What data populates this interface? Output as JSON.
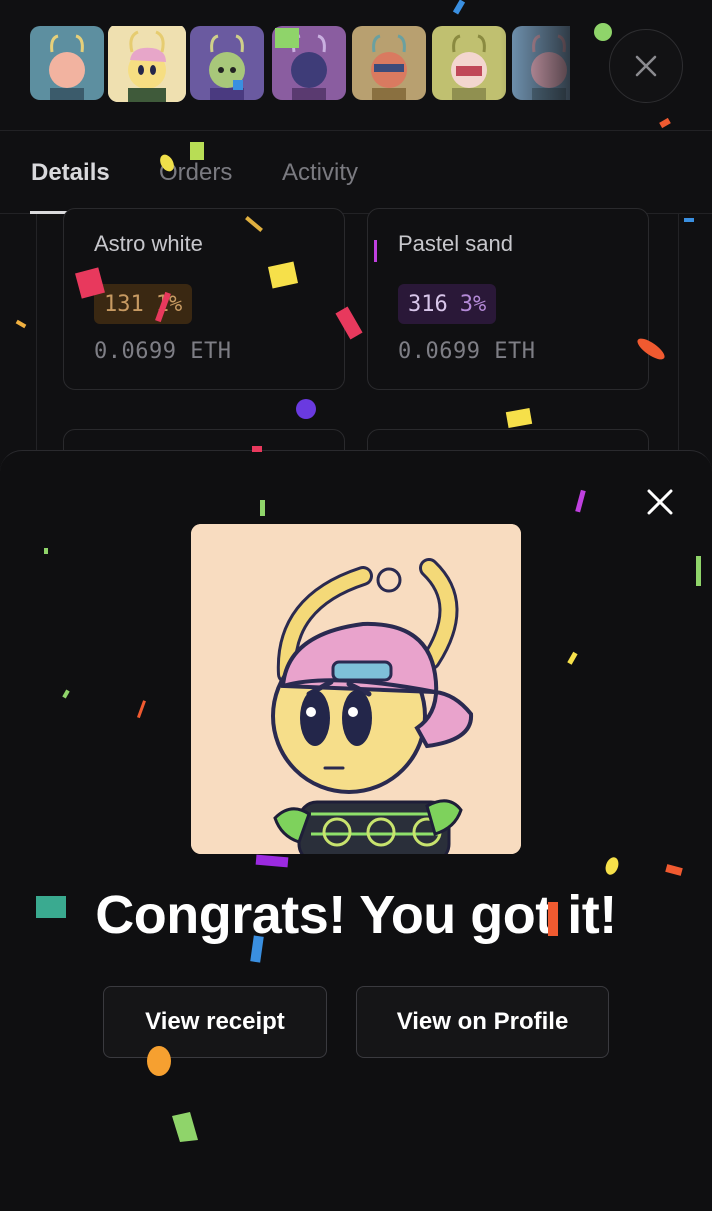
{
  "thumbnails": [
    {
      "name": "thumb-1",
      "bg": "#5d8fa0"
    },
    {
      "name": "thumb-2",
      "bg": "#efe0b0",
      "selected": true
    },
    {
      "name": "thumb-3",
      "bg": "#6a5aa0"
    },
    {
      "name": "thumb-4",
      "bg": "#8a5da0"
    },
    {
      "name": "thumb-5",
      "bg": "#b8a070"
    },
    {
      "name": "thumb-6",
      "bg": "#c0c070"
    },
    {
      "name": "thumb-7",
      "bg": "#7aa0c0"
    }
  ],
  "tabs": {
    "details": "Details",
    "orders": "Orders",
    "activity": "Activity"
  },
  "cards": [
    {
      "name": "Astro white",
      "count": "131",
      "pct": "1%",
      "price": "0.0699",
      "currency": "ETH",
      "pill_bg": "#3a2812",
      "pill_fg": "#c79a62"
    },
    {
      "name": "Pastel sand",
      "count": "316",
      "pct": "3%",
      "price": "0.0699",
      "currency": "ETH",
      "pill_bg": "#2a1838",
      "pill_fg": "#b389d6"
    }
  ],
  "modal": {
    "title": "Congrats! You got it!",
    "view_receipt": "View receipt",
    "view_on_profile": "View on Profile"
  },
  "colors": {
    "background": "#101012",
    "sheet": "#0f0f11",
    "art_bg": "#f8dcc0"
  }
}
